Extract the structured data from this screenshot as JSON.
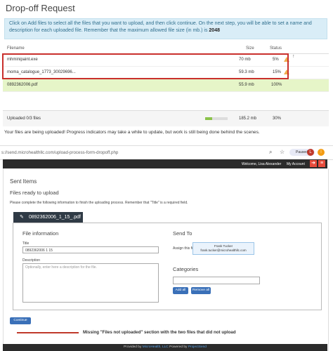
{
  "page_title": "Drop-off Request",
  "info": {
    "text": "Click on Add files to select all the files that you want to upload, and then click continue. On the next step, you will be able to set a name and description for each uploaded file. Remember that the maximum allowed file size (in mb.) is ",
    "max_size": "2048"
  },
  "upload_table": {
    "headers": {
      "filename": "Filename",
      "size": "Size",
      "status": "Status"
    },
    "rows": [
      {
        "name": "mhminipaint.exe",
        "size": "70 mb",
        "status": "5%"
      },
      {
        "name": "moma_catalogue_1773_30029696...",
        "size": "59.3 mb",
        "status": "15%"
      },
      {
        "name": "0892362006.pdf",
        "size": "55.9 mb",
        "status": "100%"
      }
    ],
    "footer": {
      "label": "Uploaded 0/3 files",
      "progress_fraction": 0.3,
      "size": "185.2 mb",
      "status": "30%"
    }
  },
  "message": "Your files are being uploaded! Progress indicators may take a while to update, but work is still being done behind the scenes.",
  "browser": {
    "url": "s://send.microhealthllc.com/upload-process-form-dropoff.php",
    "paused_label": "Paused",
    "avatar_letter": "L"
  },
  "appbar": {
    "welcome": "Welcome, Lisa Alexander",
    "account": "My Account"
  },
  "sent_items": "Sent Items",
  "files_ready": "Files ready to upload",
  "instructions": "Please complete the following information to finish the uploading process. Remember that \"Title\" is a required field.",
  "file_tab": "0892362006_1_15_.pdf",
  "file_info": {
    "heading": "File information",
    "title_label": "Title",
    "title_value": "0892362006 1 15",
    "desc_label": "Description",
    "desc_placeholder": "Optionally, enter here a description for the file."
  },
  "send_to": {
    "heading": "Send To",
    "assign_label": "Assign this file to:",
    "recipient_name": "Frank Tucker",
    "recipient_email": "frank.tucker@microhealthllc.com"
  },
  "categories": {
    "heading": "Categories",
    "add_all": "Add all",
    "remove_all": "Remove all"
  },
  "continue_label": "Continue",
  "annotation": "Missing \"Files not uploaded\" section with the two files that did not upload",
  "footer": {
    "prefix": "Provided by",
    "company": "MicroHealth, LLC",
    "powered": "Powered by",
    "product": "ProjectSend"
  },
  "colors": {
    "accent": "#3a70b8",
    "warning": "#f0ad4e",
    "highlight": "#c9302c",
    "progress": "#8bc34a"
  }
}
